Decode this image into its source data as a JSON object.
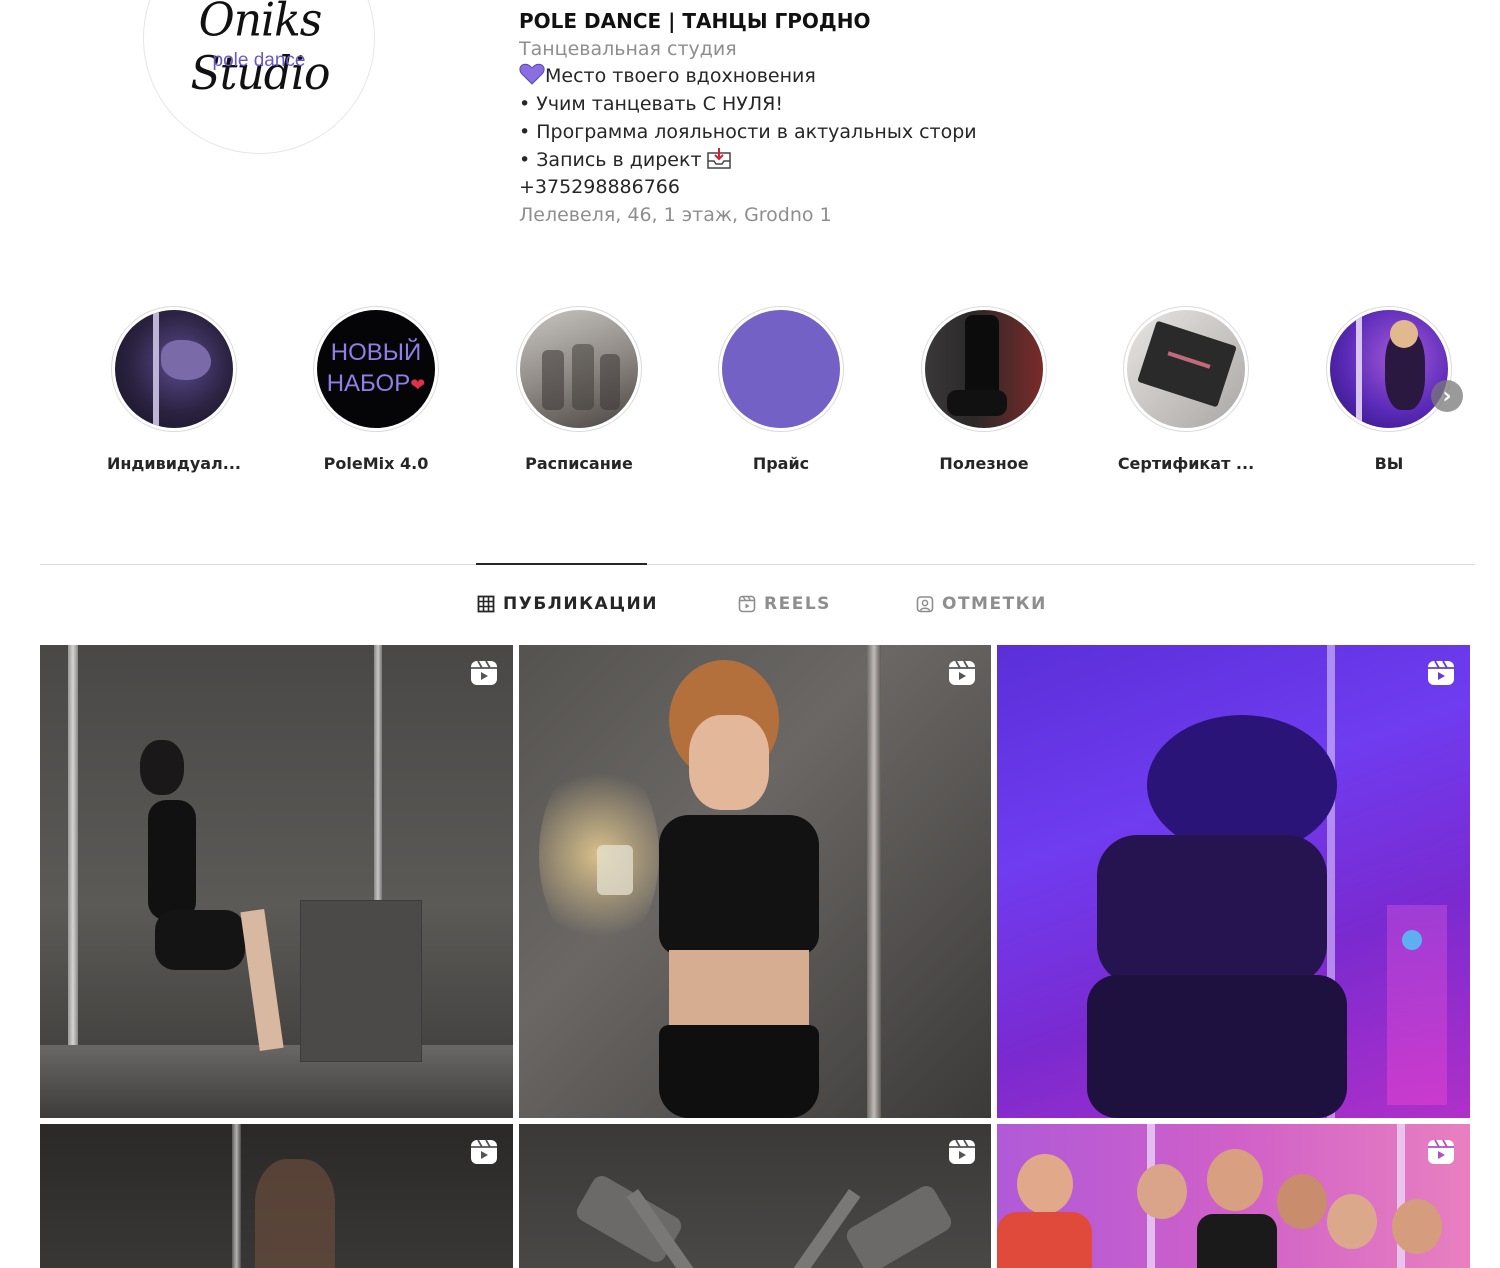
{
  "profile": {
    "avatar_logo": "Oniks Studio",
    "avatar_sub": "pole dance",
    "name": "POLE DANCE | ТАНЦЫ ГРОДНО",
    "category": "Танцевальная студия",
    "bio_lines": [
      "Место твоего вдохновения",
      "• Учим танцевать С НУЛЯ!",
      "• Программа лояльности в актуальных стори",
      "• Запись в директ"
    ],
    "phone": "+375298886766",
    "address": "Лелевеля, 46, 1 этаж, Grodno 1"
  },
  "highlights": [
    {
      "label": "Индивидуал...",
      "icon": "pole-dancer-photo"
    },
    {
      "label": "PoleMix 4.0",
      "icon": "new-recruitment-badge",
      "badge_text_1": "НОВЫЙ",
      "badge_text_2": "НАБОР"
    },
    {
      "label": "Расписание",
      "icon": "heels-photo"
    },
    {
      "label": "Прайс",
      "icon": "purple-circle"
    },
    {
      "label": "Полезное",
      "icon": "boots-photo"
    },
    {
      "label": "Сертификат ...",
      "icon": "certificate-photo"
    },
    {
      "label": "ВЫ",
      "icon": "dancer-purple-photo"
    }
  ],
  "tabs": [
    {
      "label": "ПУБЛИКАЦИИ",
      "icon": "grid-icon",
      "active": true
    },
    {
      "label": "REELS",
      "icon": "reels-icon",
      "active": false
    },
    {
      "label": "ОТМЕТКИ",
      "icon": "tagged-icon",
      "active": false
    }
  ],
  "posts": [
    {
      "name": "post-kneeling-dancer",
      "type": "reel"
    },
    {
      "name": "post-dancer-with-glass",
      "type": "reel"
    },
    {
      "name": "post-purple-backbend",
      "type": "reel"
    },
    {
      "name": "post-dark-pole",
      "type": "reel"
    },
    {
      "name": "post-pole-heels",
      "type": "reel"
    },
    {
      "name": "post-group-photo",
      "type": "reel"
    }
  ],
  "colors": {
    "accent": "#6f5bd0",
    "text": "#262626",
    "muted": "#8e8e8e",
    "border": "#dbdbdb"
  }
}
